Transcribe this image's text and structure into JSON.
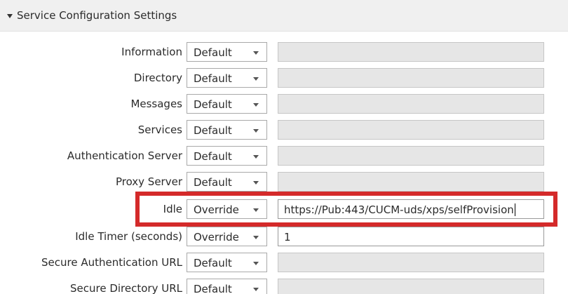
{
  "section": {
    "title": "Service Configuration Settings",
    "icon": "collapse-arrow-icon"
  },
  "rows": [
    {
      "label": "Information",
      "mode": "Default",
      "value": ""
    },
    {
      "label": "Directory",
      "mode": "Default",
      "value": ""
    },
    {
      "label": "Messages",
      "mode": "Default",
      "value": ""
    },
    {
      "label": "Services",
      "mode": "Default",
      "value": ""
    },
    {
      "label": "Authentication Server",
      "mode": "Default",
      "value": ""
    },
    {
      "label": "Proxy Server",
      "mode": "Default",
      "value": ""
    },
    {
      "label": "Idle",
      "mode": "Override",
      "value": "https://Pub:443/CUCM-uds/xps/selfProvision"
    },
    {
      "label": "Idle Timer (seconds)",
      "mode": "Override",
      "value": "1"
    },
    {
      "label": "Secure Authentication URL",
      "mode": "Default",
      "value": ""
    },
    {
      "label": "Secure Directory URL",
      "mode": "Default",
      "value": ""
    }
  ],
  "colors": {
    "highlight": "#d42a2a",
    "disabled_field": "#e6e6e6",
    "header_bg": "#f0f0f0"
  }
}
